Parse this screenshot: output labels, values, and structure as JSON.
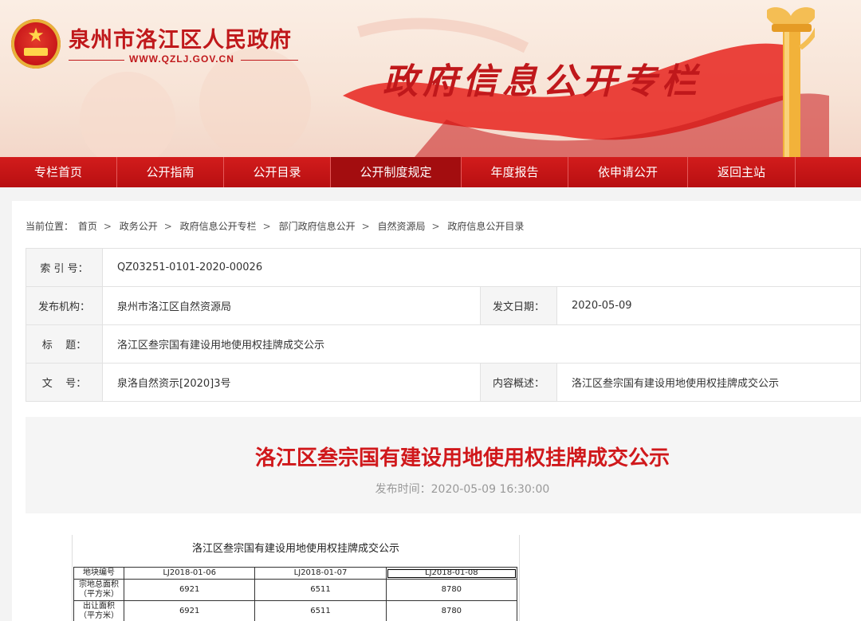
{
  "header": {
    "site_name": "泉州市洛江区人民政府",
    "site_url": "WWW.QZLJ.GOV.CN",
    "banner_title": "政府信息公开专栏"
  },
  "nav": {
    "items": [
      "专栏首页",
      "公开指南",
      "公开目录",
      "公开制度规定",
      "年度报告",
      "依申请公开",
      "返回主站"
    ],
    "active_index": 3
  },
  "breadcrumb": {
    "label": "当前位置：",
    "items": [
      "首页",
      "政务公开",
      "政府信息公开专栏",
      "部门政府信息公开",
      "自然资源局",
      "政府信息公开目录"
    ],
    "separator": ">"
  },
  "meta": {
    "index_label": "索 引 号：",
    "index_value": "QZ03251-0101-2020-00026",
    "org_label": "发布机构：",
    "org_value": "泉州市洛江区自然资源局",
    "date_label": "发文日期：",
    "date_value": "2020-05-09",
    "title_label": "标    题：",
    "title_value": "洛江区叁宗国有建设用地使用权挂牌成交公示",
    "docno_label": "文    号：",
    "docno_value": "泉洛自然资示[2020]3号",
    "summary_label": "内容概述：",
    "summary_value": "洛江区叁宗国有建设用地使用权挂牌成交公示"
  },
  "article": {
    "title": "洛江区叁宗国有建设用地使用权挂牌成交公示",
    "pub_time": "发布时间：2020-05-09 16:30:00"
  },
  "doc_table": {
    "title": "洛江区叁宗国有建设用地使用权挂牌成交公示",
    "row_headers": [
      "地块编号",
      "宗地总面积\n（平方米）",
      "出让面积\n（平方米）"
    ],
    "columns": [
      "LJ2018-01-06",
      "LJ2018-01-07",
      "LJ2018-01-08"
    ],
    "rows": [
      [
        "6921",
        "6511",
        "8780"
      ],
      [
        "6921",
        "6511",
        "8780"
      ]
    ]
  },
  "colors": {
    "brand_red": "#c0181b",
    "nav_red": "#d21c1c",
    "nav_active": "#a30d0f",
    "title_red": "#d0181b"
  }
}
